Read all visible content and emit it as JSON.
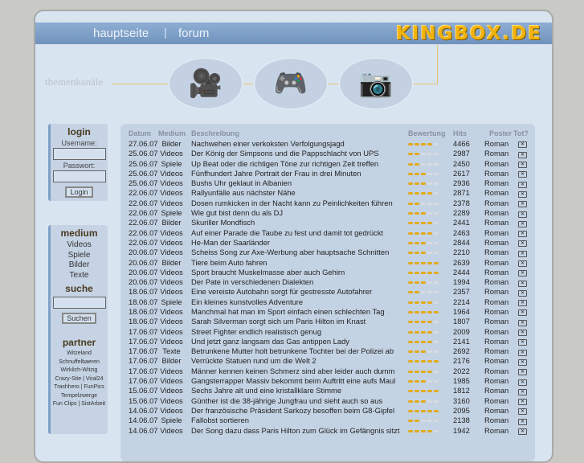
{
  "nav": {
    "home": "hauptseite",
    "sep": "|",
    "forum": "forum",
    "logo": "KINGBOX.DE"
  },
  "themen": "themenkanäle",
  "login": {
    "title": "login",
    "username_label": "Username:",
    "password_label": "Passwort:",
    "button": "Login"
  },
  "medium": {
    "title": "medium",
    "items": [
      "Videos",
      "Spiele",
      "Bilder",
      "Texte"
    ]
  },
  "suche": {
    "title": "suche",
    "button": "Suchen"
  },
  "partner": {
    "title": "partner",
    "lines": [
      "Witzeland",
      "Schnuffelbaeren",
      "Wirklich-Witzig",
      "Crazy-Site | Viral24",
      "Trashhero | FunPics",
      "Tempelzwerge",
      "Fun Clips | SistArbeit"
    ]
  },
  "colors": {
    "rating_on": "#e3a915",
    "nav": "#7a9cc4"
  },
  "table": {
    "headers": [
      "Datum",
      "Medium",
      "Beschreibung",
      "Bewertung",
      "Hits",
      "Poster",
      "Tot?"
    ],
    "rows": [
      [
        "27.06.07",
        "Bilder",
        "Nachwehen einer verkoksten Verfolgungsjagd",
        4,
        "4466",
        "Roman"
      ],
      [
        "25.06.07",
        "Videos",
        "Der König der Simpsons und die Pappschlacht von UPS",
        2,
        "2987",
        "Roman"
      ],
      [
        "25.06.07",
        "Spiele",
        "Up Beat oder die richtigen Töne zur richtigen Zeit treffen",
        2,
        "2450",
        "Roman"
      ],
      [
        "25.06.07",
        "Videos",
        "Fünfhundert Jahre Portrait der Frau in drei Minuten",
        3,
        "2617",
        "Roman"
      ],
      [
        "25.06.07",
        "Videos",
        "Bushs Uhr geklaut in Albanien",
        3,
        "2936",
        "Roman"
      ],
      [
        "22.06.07",
        "Videos",
        "Rallyunfälle aus nächster Nähe",
        4,
        "2871",
        "Roman"
      ],
      [
        "22.06.07",
        "Videos",
        "Dosen rumkicken in der Nacht kann zu Peinlichkeiten führen",
        2,
        "2378",
        "Roman"
      ],
      [
        "22.06.07",
        "Spiele",
        "Wie gut bist denn du als DJ",
        3,
        "2289",
        "Roman"
      ],
      [
        "22.06.07",
        "Bilder",
        "Skuriller Mondfisch",
        4,
        "2441",
        "Roman"
      ],
      [
        "22.06.07",
        "Videos",
        "Auf einer Parade die Taube zu fest und damit tot gedrückt",
        4,
        "2463",
        "Roman"
      ],
      [
        "22.06.07",
        "Videos",
        "He-Man der Saarländer",
        3,
        "2844",
        "Roman"
      ],
      [
        "20.06.07",
        "Videos",
        "Scheiss Song zur Axe-Werbung aber hauptsache Schnitten",
        3,
        "2210",
        "Roman"
      ],
      [
        "20.06.07",
        "Bilder",
        "Tiere beim Auto fahren",
        5,
        "2639",
        "Roman"
      ],
      [
        "20.06.07",
        "Videos",
        "Sport braucht Muskelmasse aber auch Gehirn",
        5,
        "2444",
        "Roman"
      ],
      [
        "20.06.07",
        "Videos",
        "Der Pate in verschiedenen Dialekten",
        3,
        "1994",
        "Roman"
      ],
      [
        "18.06.07",
        "Videos",
        "Eine vereiste Autobahn sorgt für gestresste Autofahrer",
        2,
        "2357",
        "Roman"
      ],
      [
        "18.06.07",
        "Spiele",
        "Ein kleines kunstvolles Adventure",
        4,
        "2214",
        "Roman"
      ],
      [
        "18.06.07",
        "Videos",
        "Manchmal hat man im Sport einfach einen schlechten Tag",
        5,
        "1964",
        "Roman"
      ],
      [
        "18.06.07",
        "Videos",
        "Sarah Silverman sorgt sich um Paris Hilton im Knast",
        4,
        "1807",
        "Roman"
      ],
      [
        "17.06.07",
        "Videos",
        "Street Fighter endlich realistisch genug",
        4,
        "2009",
        "Roman"
      ],
      [
        "17.06.07",
        "Videos",
        "Und jetzt ganz langsam das Gas antippen Lady",
        4,
        "2141",
        "Roman"
      ],
      [
        "17.06.07",
        "Texte",
        "Betrunkene Mutter holt betrunkene Tochter bei der Polizei ab",
        3,
        "2692",
        "Roman"
      ],
      [
        "17.06.07",
        "Bilder",
        "Verrückte Statuen rund um die Welt 2",
        5,
        "2176",
        "Roman"
      ],
      [
        "17.06.07",
        "Videos",
        "Männer kennen keinen Schmerz sind aber leider auch dumm",
        4,
        "2022",
        "Roman"
      ],
      [
        "17.06.07",
        "Videos",
        "Gangsterrapper Massiv bekommt beim Auftritt eine aufs Maul",
        3,
        "1985",
        "Roman"
      ],
      [
        "15.06.07",
        "Videos",
        "Sechs Jahre alt und eine kristallklare Stimme",
        5,
        "1812",
        "Roman"
      ],
      [
        "15.06.07",
        "Videos",
        "Günther ist die 38-jährige Jungfrau und sieht auch so aus",
        3,
        "3160",
        "Roman"
      ],
      [
        "14.06.07",
        "Videos",
        "Der französische Präsident Sarkozy besoffen beim G8-Gipfel",
        5,
        "2095",
        "Roman"
      ],
      [
        "14.06.07",
        "Spiele",
        "Fallobst sortieren",
        2,
        "2138",
        "Roman"
      ],
      [
        "14.06.07",
        "Videos",
        "Der Song dazu dass Paris Hilton zum Glück im Gefängnis sitzt",
        4,
        "1942",
        "Roman"
      ]
    ]
  }
}
